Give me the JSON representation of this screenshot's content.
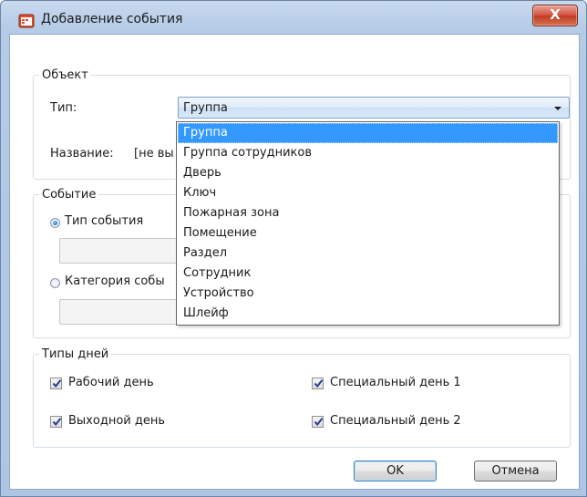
{
  "window": {
    "title": "Добавление события",
    "icons": {
      "app": "event-app-icon",
      "close": "close-icon"
    },
    "close_glyph": "X"
  },
  "object_group": {
    "legend": "Объект",
    "type_label": "Тип:",
    "type_value": "Группа",
    "name_label": "Название:",
    "name_value_partial": "[не вы"
  },
  "type_dropdown": {
    "options": [
      "Группа",
      "Группа сотрудников",
      "Дверь",
      "Ключ",
      "Пожарная зона",
      "Помещение",
      "Раздел",
      "Сотрудник",
      "Устройство",
      "Шлейф"
    ],
    "selected_index": 0
  },
  "event_group": {
    "legend": "Событие",
    "radio_event_type": "Тип события",
    "radio_event_category": "Категория собы",
    "selected_radio": "event_type"
  },
  "day_types_group": {
    "legend": "Типы дней",
    "checkboxes": [
      {
        "label": "Рабочий день",
        "checked": true
      },
      {
        "label": "Выходной день",
        "checked": true
      },
      {
        "label": "Специальный день 1",
        "checked": true
      },
      {
        "label": "Специальный день 2",
        "checked": true
      }
    ]
  },
  "buttons": {
    "ok": "OK",
    "cancel": "Отмена"
  },
  "colors": {
    "selection": "#3399ff",
    "title_bar": "#b5cbe6",
    "close_button": "#c03a24",
    "group_border": "#d5dfe5"
  }
}
